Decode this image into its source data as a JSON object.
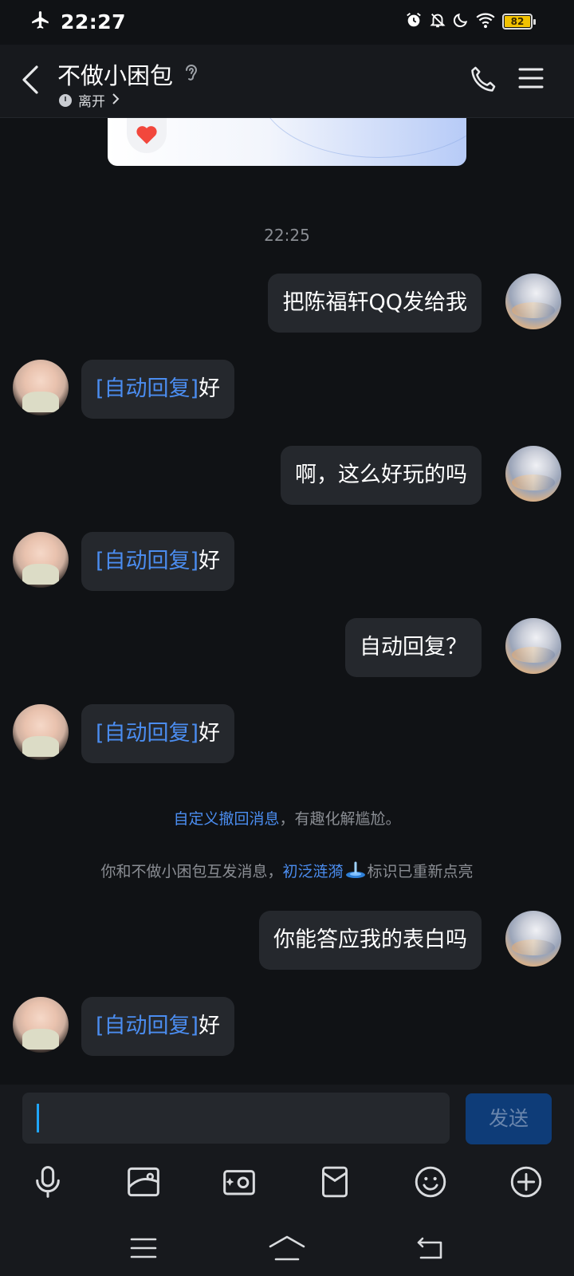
{
  "status_bar": {
    "time": "22:27",
    "battery_level": "82",
    "icons": [
      "airplane-icon",
      "alarm-icon",
      "notifications-off-icon",
      "moon-icon",
      "wifi-icon",
      "battery-icon"
    ]
  },
  "header": {
    "contact_name": "不做小困包",
    "presence": "离开",
    "icons": [
      "back-icon",
      "ear-icon",
      "clock-icon",
      "phone-icon",
      "menu-icon"
    ]
  },
  "colors": {
    "background": "#101215",
    "bubble": "#25282d",
    "accent": "#4b8df0",
    "send_button": "#0e3c78"
  },
  "chat": {
    "timestamp": "22:25",
    "messages": [
      {
        "side": "self",
        "text": "把陈福轩QQ发给我"
      },
      {
        "side": "peer",
        "tag": "[自动回复]",
        "text": "好"
      },
      {
        "side": "self",
        "text": "啊，这么好玩的吗"
      },
      {
        "side": "peer",
        "tag": "[自动回复]",
        "text": "好"
      },
      {
        "side": "self",
        "text": "自动回复？"
      },
      {
        "side": "peer",
        "tag": "[自动回复]",
        "text": "好"
      },
      {
        "side": "self",
        "text": "你能答应我的表白吗"
      },
      {
        "side": "peer",
        "tag": "[自动回复]",
        "text": "好"
      }
    ],
    "system_recall": {
      "link": "自定义撤回消息",
      "text": "，有趣化解尴尬。"
    },
    "system_badge": {
      "prefix": "你和不做小困包互发消息，",
      "link": "初泛涟漪",
      "suffix": "标识已重新点亮"
    }
  },
  "input": {
    "value": "",
    "send_label": "发送",
    "tools": [
      "microphone-icon",
      "image-icon",
      "camera-icon",
      "file-icon",
      "emoji-icon",
      "plus-icon"
    ]
  },
  "nav": [
    "menu-nav-icon",
    "home-nav-icon",
    "back-nav-icon"
  ]
}
